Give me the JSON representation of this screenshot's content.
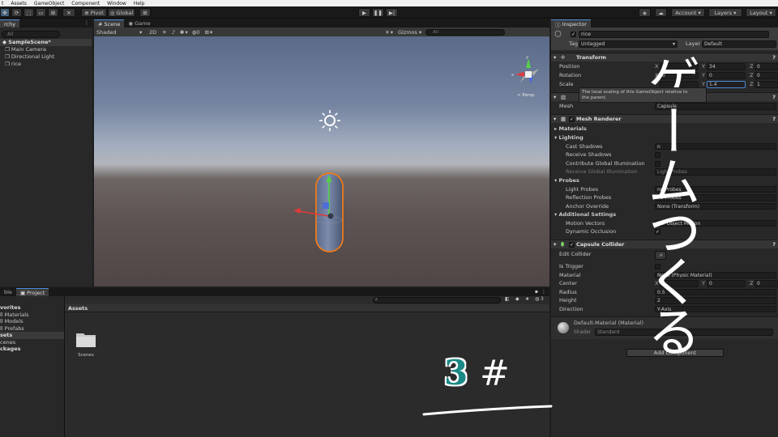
{
  "menu": [
    "t",
    "Assets",
    "GameObject",
    "Component",
    "Window",
    "Help"
  ],
  "toolbar": {
    "pivot": "Pivot",
    "global": "Global",
    "account": "Account",
    "layers": "Layers",
    "layout": "Layout"
  },
  "hierarchy": {
    "tab": "rchy",
    "search_placeholder": "All",
    "scene": "SampleScene*",
    "items": [
      "Main Camera",
      "Directional Light",
      "rice"
    ]
  },
  "scene_view": {
    "tabs": [
      "Scene",
      "Game"
    ],
    "shading": "Shaded",
    "mode_2d": "2D",
    "hidden_count": "0",
    "gizmos": "Gizmos",
    "search_placeholder": "All",
    "orientation": "< Persp"
  },
  "project": {
    "tabs": [
      "ble",
      "Project"
    ],
    "tree": [
      {
        "label": "vorites",
        "bold": true
      },
      {
        "label": "ll Materials",
        "bold": false
      },
      {
        "label": "ll Models",
        "bold": false
      },
      {
        "label": "ll Prefabs",
        "bold": false
      },
      {
        "label": "sets",
        "bold": true
      },
      {
        "label": "cenes",
        "bold": false
      },
      {
        "label": "ckages",
        "bold": true
      }
    ],
    "breadcrumb": "Assets",
    "folder_label": "Scenes",
    "hidden_count": "3"
  },
  "inspector": {
    "tab": "Inspector",
    "object_name": "rice",
    "tag_label": "Tag",
    "tag_value": "Untagged",
    "layer_label": "Layer",
    "layer_value": "Default",
    "transform": {
      "header": "Transform",
      "position_label": "Position",
      "position": {
        "x": "0",
        "y": "34",
        "z": "0"
      },
      "rotation_label": "Rotation",
      "rotation": {
        "x": "0",
        "y": "0",
        "z": "0"
      },
      "scale_label": "Scale",
      "scale": {
        "y": "1.4",
        "z": "1"
      },
      "tooltip_line1": "The local scaling of this GameObject relative to",
      "tooltip_line2": "the parent."
    },
    "mesh_filter": {
      "mesh_label": "Mesh",
      "mesh_value": "Capsule"
    },
    "mesh_renderer": {
      "header": "Mesh Renderer",
      "materials": "Materials",
      "lighting": "Lighting",
      "cast_shadows": "Cast Shadows",
      "cast_shadows_value": "n",
      "receive_shadows": "Receive Shadows",
      "contribute_gi": "Contribute Global Illumination",
      "receive_gi": "Receive Global Illumination",
      "receive_gi_value": "Light Probes",
      "probes": "Probes",
      "light_probes": "Light Probes",
      "light_probes_value": "nd Probes",
      "reflection_probes": "Reflection Probes",
      "reflection_probes_value": "nd Probes",
      "anchor_override": "Anchor Override",
      "anchor_override_value": "None (Transform)",
      "additional": "Additional Settings",
      "motion_vectors": "Motion Vectors",
      "motion_vectors_value": "Per Object Motion",
      "dynamic_occlusion": "Dynamic Occlusion"
    },
    "capsule_collider": {
      "header": "Capsule Collider",
      "edit_collider": "Edit Collider",
      "is_trigger": "Is Trigger",
      "material": "Material",
      "material_value": "None (Physic Material)",
      "center": "Center",
      "center_value": {
        "x": "0",
        "y": "0",
        "z": "0"
      },
      "radius": "Radius",
      "radius_value": "0.5",
      "height": "Height",
      "height_value": "2",
      "direction": "Direction",
      "direction_value": "Y-Axis"
    },
    "material": {
      "name": "Default-Material (Material)",
      "shader_label": "Shader",
      "shader_value": "Standard"
    },
    "add_component": "Add Component"
  },
  "overlay": {
    "episode_number": "3",
    "episode_mark": "#",
    "vertical_text": "ゲームつくる"
  },
  "colors": {
    "accent_blue": "#4a8ad4",
    "outline_orange": "#f07a1a",
    "episode_teal": "#1b8a86"
  }
}
